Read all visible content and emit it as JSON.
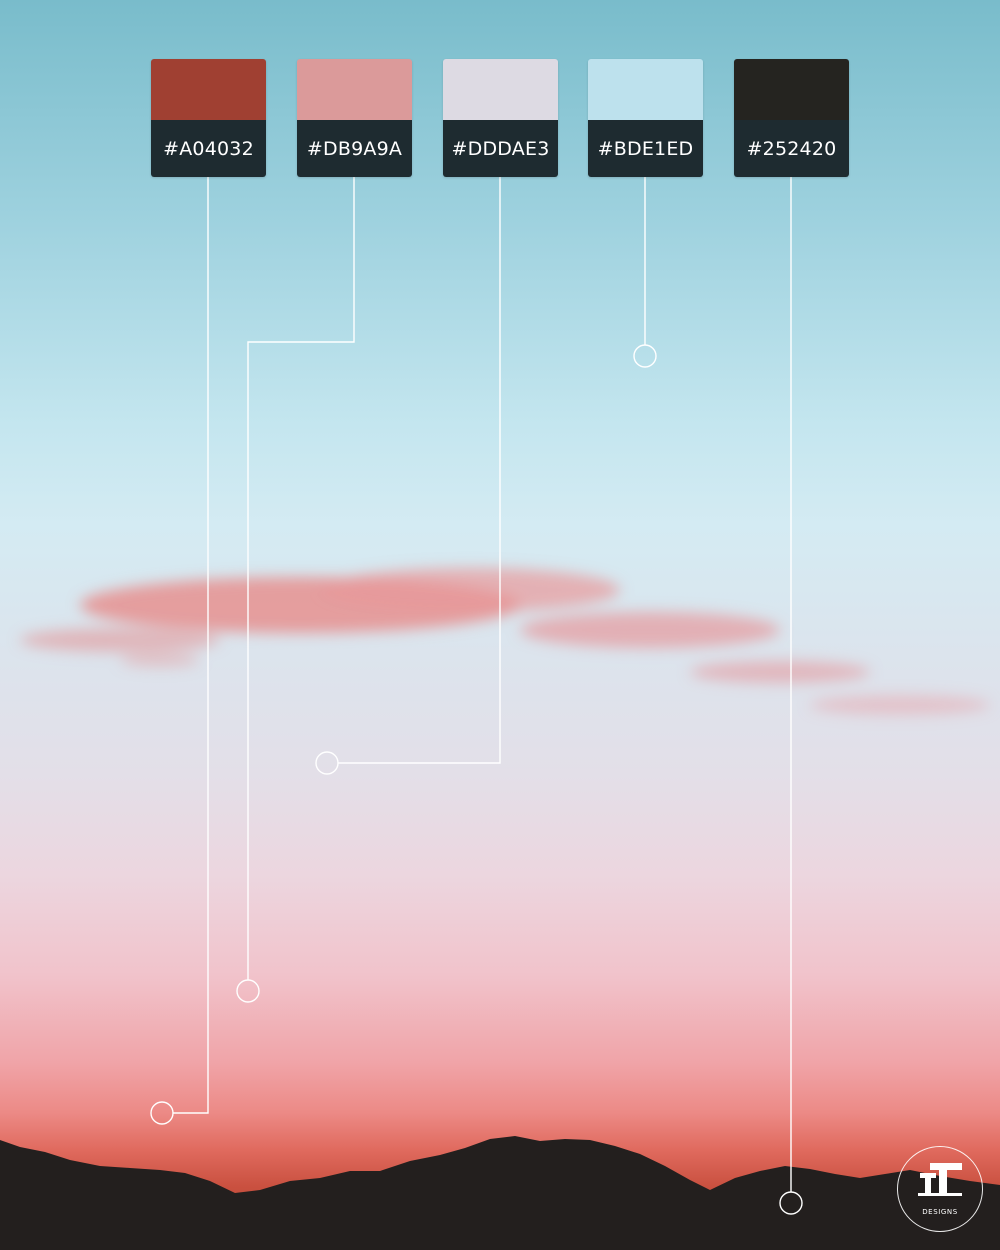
{
  "palette": [
    {
      "hex": "#A04032",
      "color": "#A04032"
    },
    {
      "hex": "#DB9A9A",
      "color": "#DB9A9A"
    },
    {
      "hex": "#DDDAE3",
      "color": "#DDDAE3"
    },
    {
      "hex": "#BDE1ED",
      "color": "#BDE1ED"
    },
    {
      "hex": "#252420",
      "color": "#252420"
    }
  ],
  "brand": {
    "logo": "TT-monogram-logo",
    "name": "DESIGNS"
  }
}
